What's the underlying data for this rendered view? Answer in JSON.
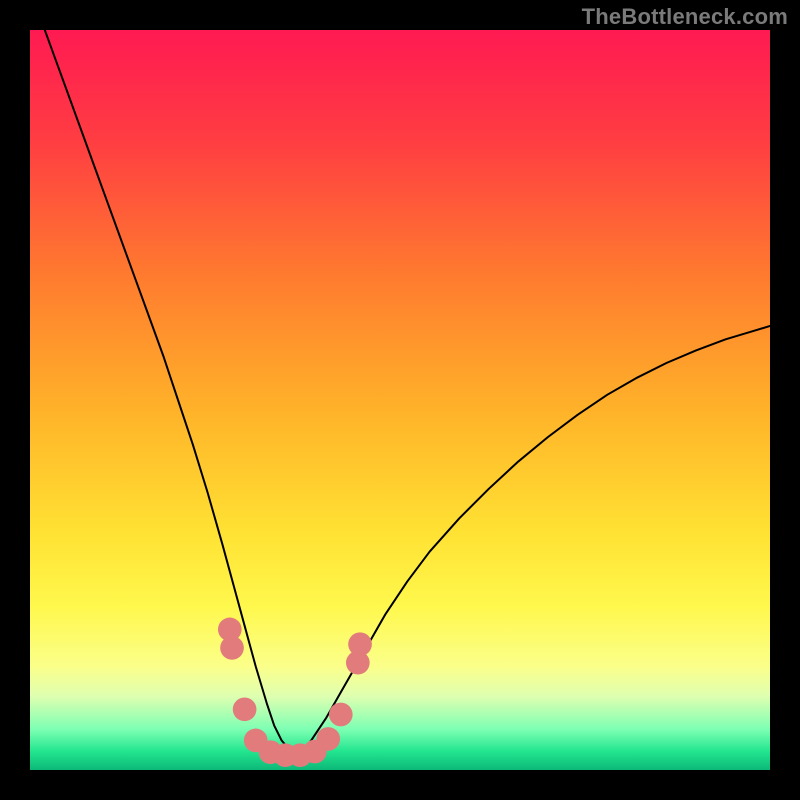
{
  "attribution": "TheBottleneck.com",
  "chart_data": {
    "type": "line",
    "title": "",
    "xlabel": "",
    "ylabel": "",
    "xlim": [
      0,
      100
    ],
    "ylim": [
      0,
      100
    ],
    "gradient_stops": [
      {
        "offset": 0.0,
        "color": "#ff1a52"
      },
      {
        "offset": 0.15,
        "color": "#ff3d42"
      },
      {
        "offset": 0.33,
        "color": "#ff7a2f"
      },
      {
        "offset": 0.52,
        "color": "#ffb429"
      },
      {
        "offset": 0.68,
        "color": "#ffe233"
      },
      {
        "offset": 0.78,
        "color": "#fff84d"
      },
      {
        "offset": 0.86,
        "color": "#fbff8a"
      },
      {
        "offset": 0.9,
        "color": "#dfffb0"
      },
      {
        "offset": 0.945,
        "color": "#7dffb3"
      },
      {
        "offset": 0.975,
        "color": "#22e58f"
      },
      {
        "offset": 1.0,
        "color": "#0cb878"
      }
    ],
    "series": [
      {
        "name": "left-arm",
        "x": [
          2,
          4,
          6,
          8,
          10,
          12,
          14,
          16,
          18,
          20,
          22,
          24,
          26,
          27.5,
          29,
          30.5,
          32,
          33,
          34,
          35,
          36
        ],
        "y": [
          100,
          94.5,
          89.0,
          83.5,
          78.0,
          72.5,
          67.0,
          61.5,
          56.0,
          50.0,
          44.0,
          37.5,
          30.5,
          25.0,
          19.5,
          14.0,
          9.0,
          6.0,
          4.0,
          2.8,
          2.0
        ]
      },
      {
        "name": "right-arm",
        "x": [
          36,
          37,
          38,
          40,
          42,
          44,
          46,
          48,
          51,
          54,
          58,
          62,
          66,
          70,
          74,
          78,
          82,
          86,
          90,
          94,
          98,
          100
        ],
        "y": [
          2.0,
          2.8,
          4.0,
          7.0,
          10.5,
          14.0,
          17.5,
          21.0,
          25.5,
          29.5,
          34.0,
          38.0,
          41.7,
          45.0,
          48.0,
          50.7,
          53.0,
          55.0,
          56.7,
          58.2,
          59.4,
          60.0
        ]
      }
    ],
    "markers": {
      "name": "bottom-bumps",
      "color": "#e27c7c",
      "points": [
        {
          "x": 27.0,
          "y": 19.0,
          "r": 1.6
        },
        {
          "x": 27.3,
          "y": 16.5,
          "r": 1.6
        },
        {
          "x": 29.0,
          "y": 8.2,
          "r": 1.6
        },
        {
          "x": 30.5,
          "y": 4.0,
          "r": 1.6
        },
        {
          "x": 32.5,
          "y": 2.4,
          "r": 1.6
        },
        {
          "x": 34.5,
          "y": 2.0,
          "r": 1.6
        },
        {
          "x": 36.5,
          "y": 2.0,
          "r": 1.6
        },
        {
          "x": 38.5,
          "y": 2.5,
          "r": 1.6
        },
        {
          "x": 40.3,
          "y": 4.2,
          "r": 1.6
        },
        {
          "x": 42.0,
          "y": 7.5,
          "r": 1.6
        },
        {
          "x": 44.3,
          "y": 14.5,
          "r": 1.6
        },
        {
          "x": 44.6,
          "y": 17.0,
          "r": 1.6
        }
      ]
    }
  }
}
